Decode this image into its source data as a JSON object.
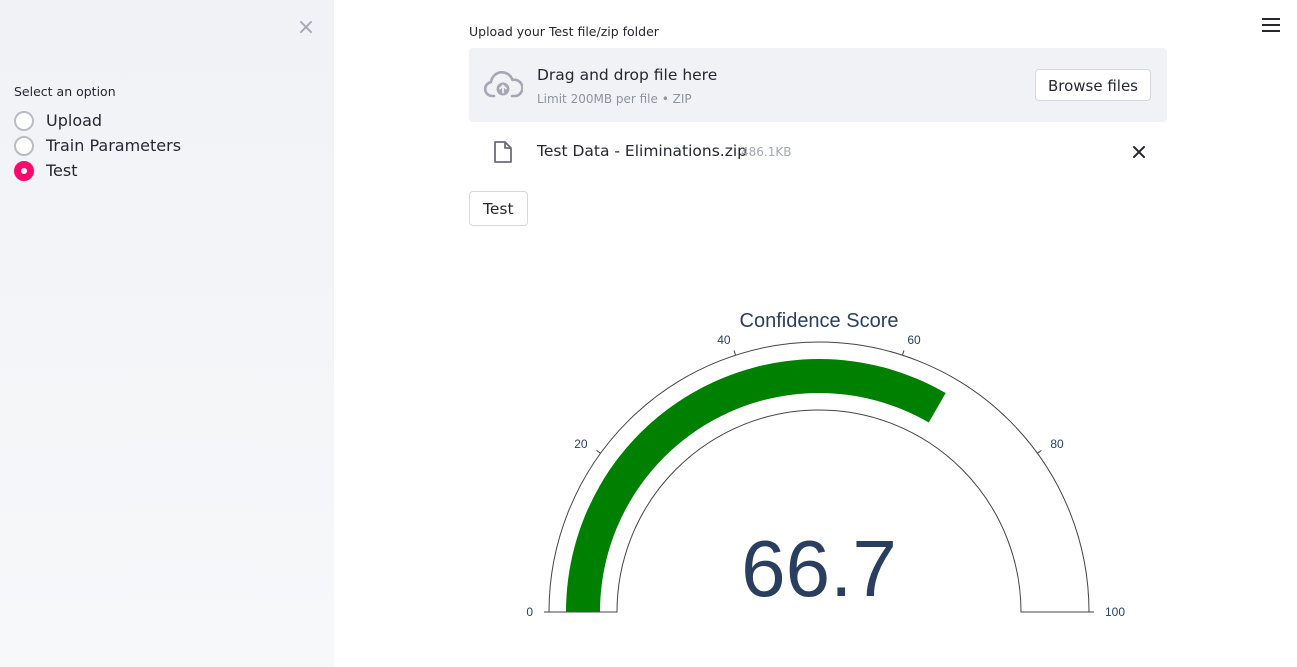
{
  "sidebar": {
    "close_symbol": "×",
    "radio_title": "Select an option",
    "options": [
      {
        "label": "Upload",
        "selected": false
      },
      {
        "label": "Train Parameters",
        "selected": false
      },
      {
        "label": "Test",
        "selected": true
      }
    ],
    "accent_color": "#ff0a6c"
  },
  "main": {
    "upload_label": "Upload your Test file/zip folder",
    "dropzone": {
      "title": "Drag and drop file here",
      "subtitle": "Limit 200MB per file • ZIP",
      "browse_label": "Browse files",
      "icon": "cloud-upload-icon"
    },
    "uploaded_file": {
      "name": "Test Data - Eliminations.zip",
      "size": "486.1KB",
      "icon": "file-icon",
      "remove_icon": "close-icon"
    },
    "test_button": "Test"
  },
  "chart_data": {
    "type": "gauge",
    "title": "Confidence Score",
    "value": 66.7,
    "value_label": "66.7",
    "range": [
      0,
      100
    ],
    "ticks": [
      0,
      20,
      40,
      60,
      80,
      100
    ],
    "tick_labels": [
      "0",
      "20",
      "40",
      "60",
      "80",
      "100"
    ],
    "bar_color": "#008000",
    "text_color": "#2a3f5f"
  }
}
